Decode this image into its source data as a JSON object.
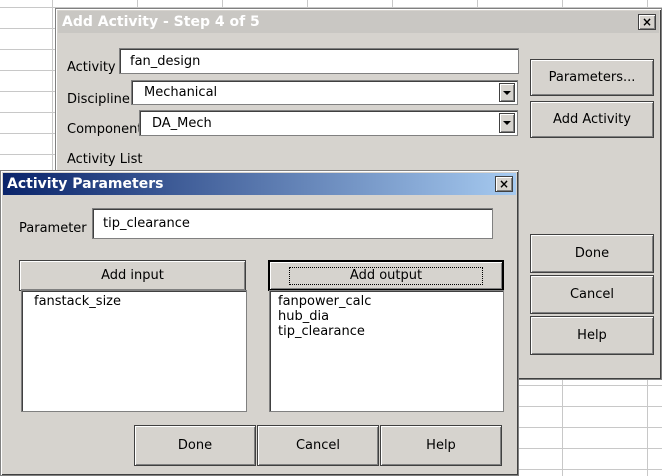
{
  "main_dialog": {
    "title": "Add Activity - Step 4 of 5",
    "close_label": "×",
    "activity": {
      "label": "Activity",
      "value": "fan_design"
    },
    "discipline": {
      "label": "Discipline",
      "value": "Mechanical"
    },
    "component": {
      "label": "Component",
      "value": "DA_Mech"
    },
    "activity_list_label": "Activity List",
    "buttons": {
      "parameters": "Parameters...",
      "add_activity": "Add Activity",
      "done": "Done",
      "cancel": "Cancel",
      "help": "Help"
    }
  },
  "params_dialog": {
    "title": "Activity Parameters",
    "close_label": "×",
    "parameter": {
      "label": "Parameter",
      "value": "tip_clearance"
    },
    "add_input_label": "Add input",
    "add_output_label": "Add output",
    "inputs": [
      "fanstack_size"
    ],
    "outputs": [
      "fanpower_calc",
      "hub_dia",
      "tip_clearance"
    ],
    "buttons": {
      "done": "Done",
      "cancel": "Cancel",
      "help": "Help"
    }
  },
  "icons": {
    "close": "close-icon",
    "dropdown": "chevron-down-icon"
  },
  "colors": {
    "active_title": "#0a246a",
    "inactive_title": "#c9c7c3",
    "dialog_face": "#d6d3ce"
  }
}
